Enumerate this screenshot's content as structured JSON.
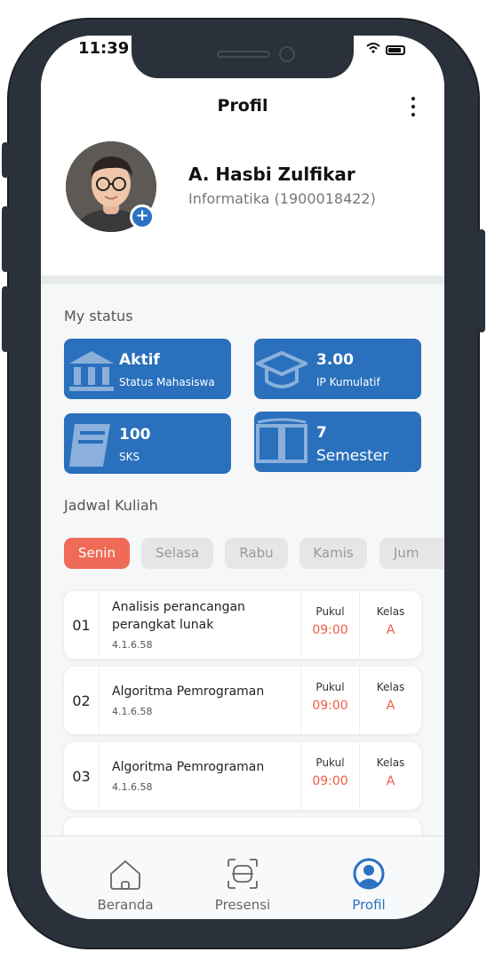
{
  "status_bar": {
    "time": "11:39"
  },
  "header": {
    "title": "Profil"
  },
  "profile": {
    "name": "A. Hasbi Zulfikar",
    "subtitle": "Informatika (1900018422)"
  },
  "my_status": {
    "title": "My status",
    "cards": [
      {
        "value": "Aktif",
        "label": "Status Mahasiswa",
        "icon": "bank-icon"
      },
      {
        "value": "3.00",
        "label": "IP Kumulatif",
        "icon": "graduation-cap-icon"
      },
      {
        "value": "100",
        "label": "SKS",
        "icon": "book-icon"
      },
      {
        "value": "7",
        "label": "Semester",
        "icon": "open-book-icon"
      }
    ]
  },
  "schedule": {
    "title": "Jadwal Kuliah",
    "days": [
      "Senin",
      "Selasa",
      "Rabu",
      "Kamis",
      "Jum"
    ],
    "active_day": "Senin",
    "columns": {
      "time": "Pukul",
      "class": "Kelas"
    },
    "courses": [
      {
        "num": "01",
        "name": "Analisis perancangan perangkat lunak",
        "code": "4.1.6.58",
        "time": "09:00",
        "class": "A"
      },
      {
        "num": "02",
        "name": "Algoritma Pemrograman",
        "code": "4.1.6.58",
        "time": "09:00",
        "class": "A"
      },
      {
        "num": "03",
        "name": "Algoritma Pemrograman",
        "code": "4.1.6.58",
        "time": "09:00",
        "class": "A"
      }
    ]
  },
  "tabbar": {
    "items": [
      {
        "label": "Beranda",
        "icon": "home-icon"
      },
      {
        "label": "Presensi",
        "icon": "scan-icon"
      },
      {
        "label": "Profil",
        "icon": "profile-icon"
      }
    ],
    "active": "Profil"
  },
  "colors": {
    "accent": "#2a70bd",
    "active_day": "#ef6b57",
    "time_value": "#ef5c46"
  }
}
